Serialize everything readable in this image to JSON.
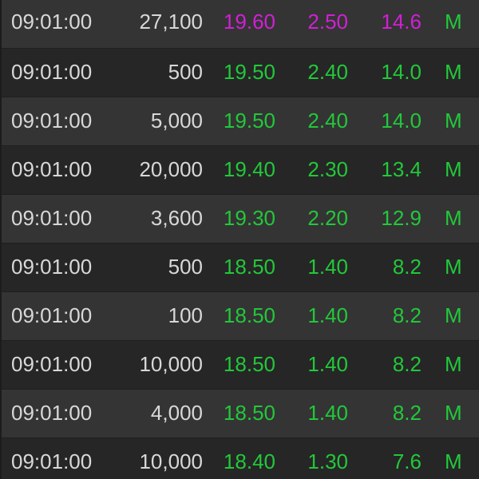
{
  "colors": {
    "background": "#2b2b2b",
    "row_odd": "#343434",
    "row_even": "#262626",
    "text_neutral": "#d8d8d8",
    "text_up": "#22c83a",
    "text_high": "#d21fd6"
  },
  "trades": [
    {
      "time": "09:01:00",
      "volume": "27,100",
      "price": "19.60",
      "change": "2.50",
      "pct": "14.6",
      "flag": "M",
      "highlight": true
    },
    {
      "time": "09:01:00",
      "volume": "500",
      "price": "19.50",
      "change": "2.40",
      "pct": "14.0",
      "flag": "M",
      "highlight": false
    },
    {
      "time": "09:01:00",
      "volume": "5,000",
      "price": "19.50",
      "change": "2.40",
      "pct": "14.0",
      "flag": "M",
      "highlight": false
    },
    {
      "time": "09:01:00",
      "volume": "20,000",
      "price": "19.40",
      "change": "2.30",
      "pct": "13.4",
      "flag": "M",
      "highlight": false
    },
    {
      "time": "09:01:00",
      "volume": "3,600",
      "price": "19.30",
      "change": "2.20",
      "pct": "12.9",
      "flag": "M",
      "highlight": false
    },
    {
      "time": "09:01:00",
      "volume": "500",
      "price": "18.50",
      "change": "1.40",
      "pct": "8.2",
      "flag": "M",
      "highlight": false
    },
    {
      "time": "09:01:00",
      "volume": "100",
      "price": "18.50",
      "change": "1.40",
      "pct": "8.2",
      "flag": "M",
      "highlight": false
    },
    {
      "time": "09:01:00",
      "volume": "10,000",
      "price": "18.50",
      "change": "1.40",
      "pct": "8.2",
      "flag": "M",
      "highlight": false
    },
    {
      "time": "09:01:00",
      "volume": "4,000",
      "price": "18.50",
      "change": "1.40",
      "pct": "8.2",
      "flag": "M",
      "highlight": false
    },
    {
      "time": "09:01:00",
      "volume": "10,000",
      "price": "18.40",
      "change": "1.30",
      "pct": "7.6",
      "flag": "M",
      "highlight": false
    }
  ]
}
